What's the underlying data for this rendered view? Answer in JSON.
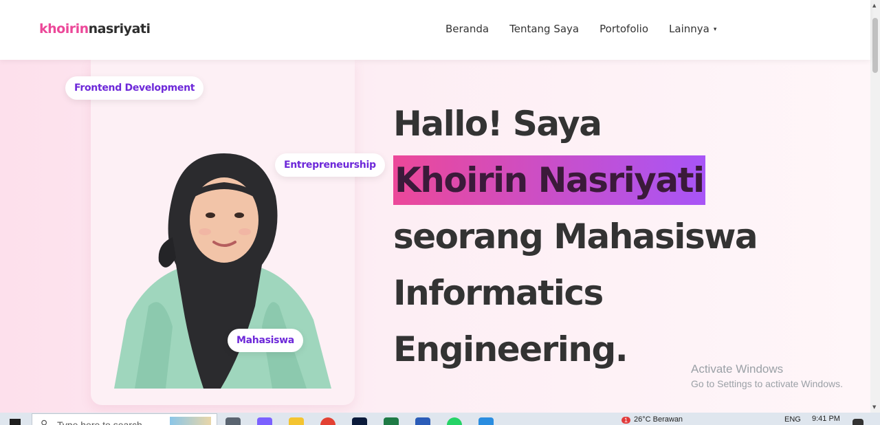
{
  "logo": {
    "part1": "khoirin",
    "part2": "nasriyati"
  },
  "nav": {
    "items": [
      "Beranda",
      "Tentang Saya",
      "Portofolio",
      "Lainnya"
    ],
    "caret": "▾"
  },
  "hero": {
    "pills": {
      "frontend": "Frontend Development",
      "entre": "Entrepreneurship",
      "mhs": "Mahasiswa"
    },
    "lines": [
      "Hallo! Saya",
      "Khoirin Nasriyati",
      "seorang Mahasiswa",
      "Informatics",
      "Engineering."
    ]
  },
  "watermark": {
    "line1": "Activate Windows",
    "line2": "Go to Settings to activate Windows."
  },
  "taskbar": {
    "search_placeholder": "Type here to search",
    "weather": "26°C  Berawan",
    "lang": "ENG",
    "time": "9:41 PM",
    "notif_count": "1"
  },
  "colors": {
    "accent_pink": "#ec4899",
    "accent_purple": "#a855f7",
    "pill_text": "#6d28d9"
  }
}
